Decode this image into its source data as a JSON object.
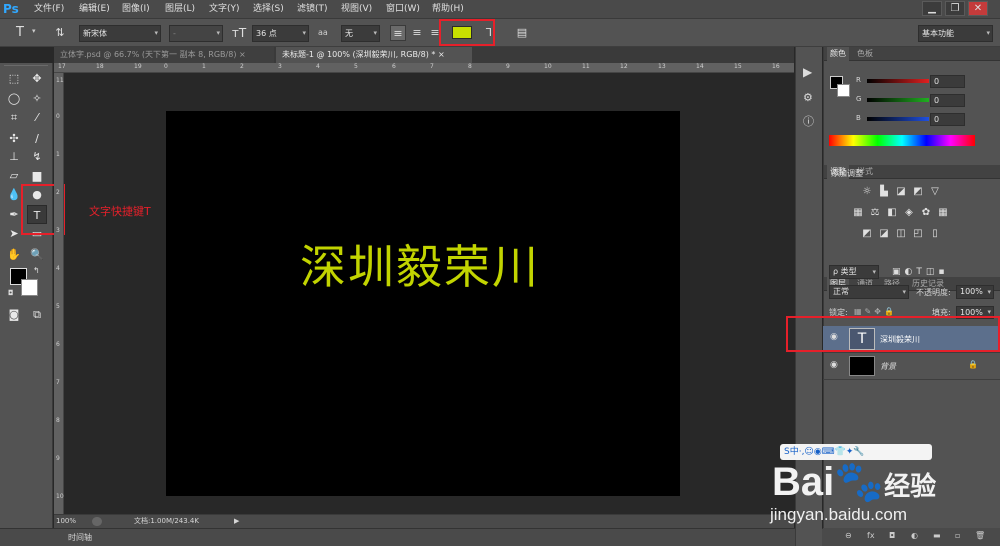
{
  "app": {
    "logo": "Ps"
  },
  "menu": [
    "文件(F)",
    "编辑(E)",
    "图像(I)",
    "图层(L)",
    "文字(Y)",
    "选择(S)",
    "滤镜(T)",
    "视图(V)",
    "窗口(W)",
    "帮助(H)"
  ],
  "window_buttons": [
    "▁",
    "❐",
    "✕"
  ],
  "options": {
    "font_family": "新宋体",
    "font_style": "-",
    "font_size": "36 点",
    "antialias_label": "aa",
    "antialias": "无",
    "workspace": "基本功能",
    "text_color": "#c8e000"
  },
  "tabs": [
    {
      "label": "立体字.psd @ 66.7% (天下第一 副本 8, RGB/8)",
      "close": "×"
    },
    {
      "label": "未标题-1 @ 100% (深圳毅荣川, RGB/8) *",
      "close": "×"
    }
  ],
  "ruler_top": [
    "0",
    "1",
    "2",
    "3",
    "4",
    "5",
    "6",
    "7",
    "8",
    "9",
    "10",
    "11",
    "12",
    "13",
    "14",
    "15",
    "16",
    "17",
    "18",
    "19",
    "20",
    "21",
    "22",
    "23",
    "24",
    "25"
  ],
  "ruler_left": [
    "0",
    "1",
    "2",
    "3",
    "4",
    "5",
    "6",
    "7",
    "8",
    "9",
    "10",
    "11",
    "12",
    "13"
  ],
  "document": {
    "text": "深圳毅荣川"
  },
  "annotation": {
    "tool_hint": "文字快捷键T"
  },
  "status": {
    "zoom": "100%",
    "doc_info": "文档:1.00M/243.4K",
    "arrow": "▶"
  },
  "timeline": {
    "label": "时间轴"
  },
  "color_panel": {
    "tabs": [
      "颜色",
      "色板"
    ],
    "channels": [
      {
        "name": "R",
        "value": "0",
        "color": "#e02020"
      },
      {
        "name": "G",
        "value": "0",
        "color": "#20b020"
      },
      {
        "name": "B",
        "value": "0",
        "color": "#2050e0"
      }
    ]
  },
  "adjust_panel": {
    "tabs": [
      "调整",
      "样式"
    ],
    "title": "添加调整"
  },
  "layers_panel": {
    "tabs": [
      "图层",
      "通道",
      "路径",
      "历史记录"
    ],
    "filter": "ρ 类型",
    "blend_mode": "正常",
    "opacity_label": "不透明度:",
    "opacity": "100%",
    "lock_label": "锁定:",
    "fill_label": "填充:",
    "fill": "100%",
    "layers": [
      {
        "name": "深圳毅荣川",
        "thumb": "T"
      },
      {
        "name": "背景",
        "thumb": ""
      }
    ],
    "footer_icons": [
      "⊖",
      "fx",
      "◘",
      "◐",
      "▬",
      "▫",
      "🗑"
    ]
  },
  "watermark": {
    "ime_bar": "S中·,☺◉⌨👕✦🔧",
    "brand": "Bai",
    "brand2": "经验",
    "url": "jingyan.baidu.com"
  }
}
